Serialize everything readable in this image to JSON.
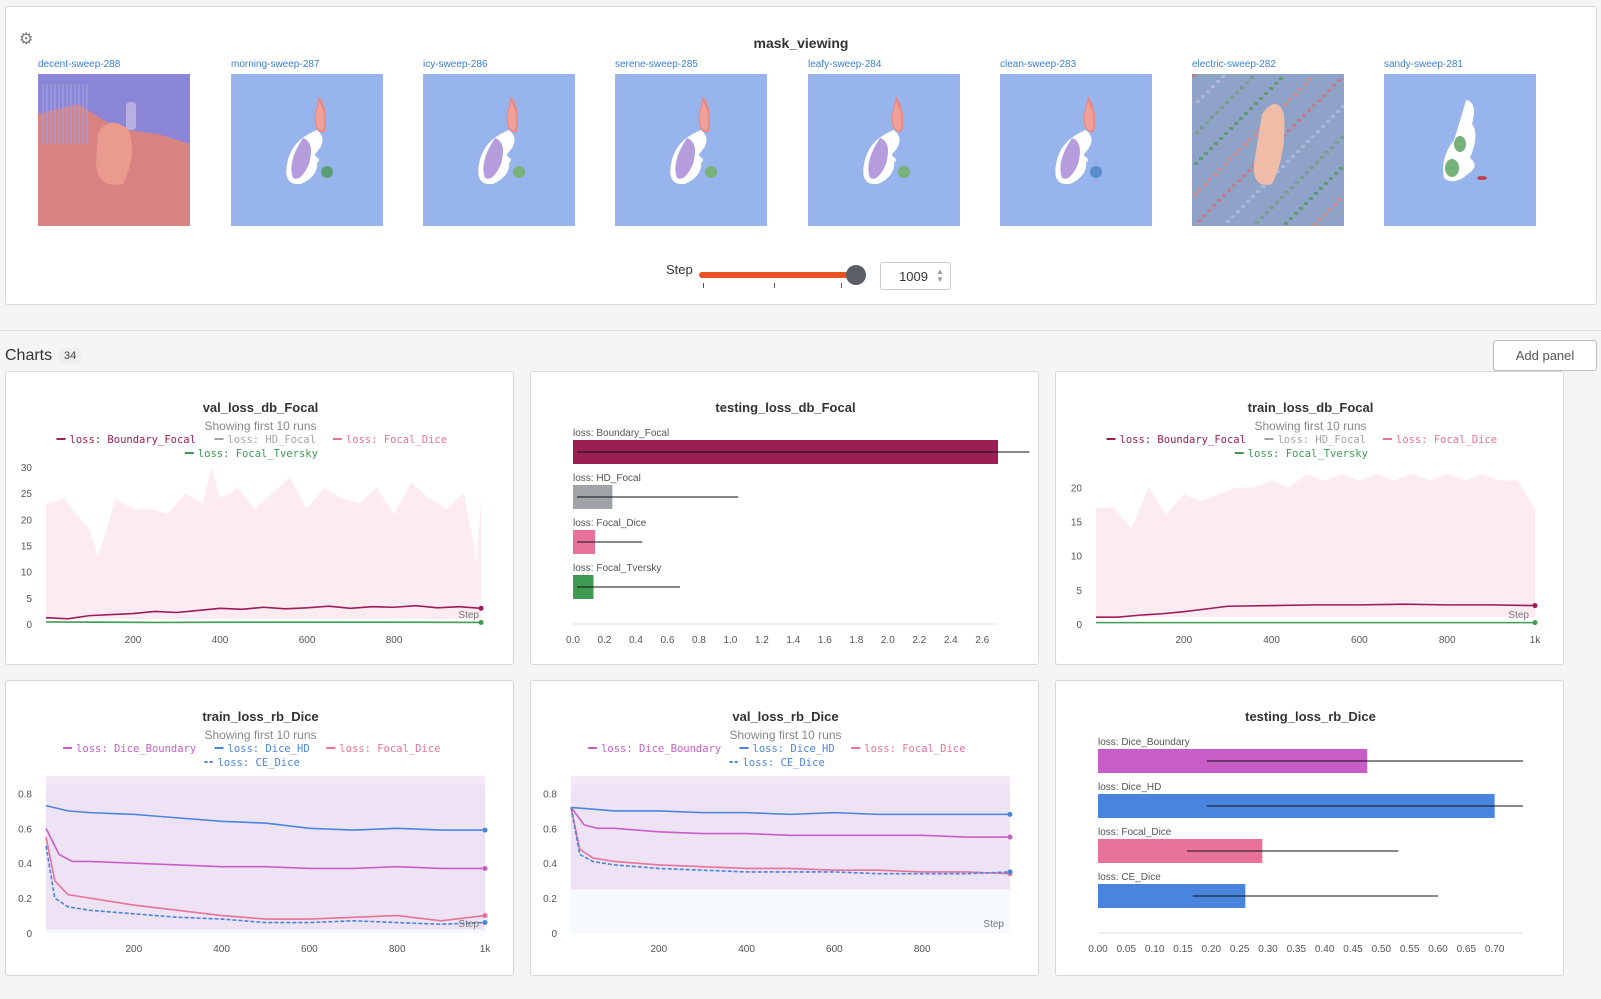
{
  "mask_panel": {
    "title": "mask_viewing",
    "runs": [
      "decent-sweep-288",
      "morning-sweep-287",
      "icy-sweep-286",
      "serene-sweep-285",
      "leafy-sweep-284",
      "clean-sweep-283",
      "electric-sweep-282",
      "sandy-sweep-281"
    ],
    "step_label": "Step",
    "step_value": "1009",
    "slider_fraction": 1.0,
    "settings_icon": "gear-icon"
  },
  "charts_section": {
    "label": "Charts",
    "count": "34",
    "add_panel": "Add panel"
  },
  "colors": {
    "Boundary_Focal": "#9b1e55",
    "HD_Focal": "#a0a4a8",
    "Focal_Dice": "#e8729a",
    "Focal_Tversky": "#3e9a52",
    "Dice_Boundary": "#c95dc8",
    "Dice_HD": "#4a85dd",
    "CE_Dice": "#4a85dd",
    "accent": "#e9541f"
  },
  "charts": [
    {
      "type": "line",
      "title": "val_loss_db_Focal",
      "subtitle": "Showing first 10 runs",
      "legend_rows": [
        [
          "Boundary_Focal",
          "HD_Focal",
          "Focal_Dice"
        ],
        [
          "Focal_Tversky"
        ]
      ],
      "ylim": [
        0,
        30
      ],
      "yticks": [
        "0",
        "5",
        "10",
        "15",
        "20",
        "25",
        "30"
      ],
      "xmin": 0,
      "xmax": 1009,
      "xticks": [
        {
          "v": 200,
          "l": "200"
        },
        {
          "v": 400,
          "l": "400"
        },
        {
          "v": 600,
          "l": "600"
        },
        {
          "v": 800,
          "l": "800"
        }
      ],
      "step_label": "Step",
      "band": {
        "color": "#e8729a",
        "lo": 1,
        "hi_x": [
          0,
          40,
          80,
          100,
          120,
          160,
          200,
          240,
          280,
          320,
          360,
          380,
          400,
          440,
          480,
          520,
          560,
          600,
          640,
          680,
          720,
          760,
          800,
          840,
          880,
          920,
          960,
          990,
          1000
        ],
        "hi_y": [
          23,
          24,
          20,
          18,
          13,
          24,
          22,
          22,
          21,
          25,
          23,
          31,
          24,
          26,
          22,
          25,
          28,
          22,
          26,
          24,
          23,
          26,
          21,
          27,
          24,
          22,
          25,
          12,
          24
        ]
      },
      "series": [
        {
          "name": "Boundary_Focal",
          "x": [
            0,
            50,
            100,
            150,
            200,
            250,
            300,
            350,
            400,
            450,
            500,
            550,
            600,
            650,
            700,
            750,
            800,
            850,
            900,
            950,
            1000
          ],
          "y": [
            1.2,
            1.0,
            1.6,
            1.8,
            2.0,
            2.4,
            2.2,
            2.6,
            3.0,
            2.8,
            3.2,
            2.9,
            3.1,
            3.4,
            3.0,
            3.3,
            3.2,
            3.5,
            3.1,
            3.3,
            3.0
          ]
        },
        {
          "name": "Focal_Tversky",
          "x": [
            0,
            250,
            500,
            750,
            1000
          ],
          "y": [
            0.4,
            0.3,
            0.35,
            0.35,
            0.3
          ]
        }
      ]
    },
    {
      "type": "hbar",
      "title": "testing_loss_db_Focal",
      "xlim": [
        0,
        2.7
      ],
      "xticks": [
        "0.0",
        "0.2",
        "0.4",
        "0.6",
        "0.8",
        "1.0",
        "1.2",
        "1.4",
        "1.6",
        "1.8",
        "2.0",
        "2.2",
        "2.4",
        "2.6"
      ],
      "bars": [
        {
          "label": "loss: Boundary_Focal",
          "key": "Boundary_Focal",
          "value": 2.7,
          "err_lo": 0.0,
          "err_hi": 2.9
        },
        {
          "label": "loss: HD_Focal",
          "key": "HD_Focal",
          "value": 0.25,
          "err_lo": 0.0,
          "err_hi": 1.05
        },
        {
          "label": "loss: Focal_Dice",
          "key": "Focal_Dice",
          "value": 0.14,
          "err_lo": 0.0,
          "err_hi": 0.44
        },
        {
          "label": "loss: Focal_Tversky",
          "key": "Focal_Tversky",
          "value": 0.13,
          "err_lo": 0.0,
          "err_hi": 0.68
        }
      ]
    },
    {
      "type": "line",
      "title": "train_loss_db_Focal",
      "subtitle": "Showing first 10 runs",
      "legend_rows": [
        [
          "Boundary_Focal",
          "HD_Focal",
          "Focal_Dice"
        ],
        [
          "Focal_Tversky"
        ]
      ],
      "ylim": [
        0,
        23
      ],
      "yticks": [
        "0",
        "5",
        "10",
        "15",
        "20"
      ],
      "xmin": 0,
      "xmax": 1000,
      "xticks": [
        {
          "v": 200,
          "l": "200"
        },
        {
          "v": 400,
          "l": "400"
        },
        {
          "v": 600,
          "l": "600"
        },
        {
          "v": 800,
          "l": "800"
        },
        {
          "v": 1000,
          "l": "1k"
        }
      ],
      "step_label": "Step",
      "band": {
        "color": "#e8729a",
        "lo": 1,
        "hi_x": [
          0,
          40,
          80,
          120,
          160,
          200,
          240,
          280,
          320,
          360,
          400,
          440,
          480,
          520,
          560,
          600,
          640,
          680,
          720,
          760,
          800,
          840,
          880,
          920,
          960,
          1000
        ],
        "hi_y": [
          17,
          17,
          14,
          20,
          16,
          19,
          18,
          19,
          20,
          20,
          21,
          20,
          22,
          21,
          22,
          21,
          22,
          21,
          22,
          21,
          22,
          21,
          22,
          21,
          21,
          17
        ]
      },
      "series": [
        {
          "name": "Boundary_Focal",
          "x": [
            0,
            50,
            100,
            150,
            200,
            250,
            300,
            400,
            500,
            600,
            700,
            800,
            900,
            1000
          ],
          "y": [
            1.0,
            1.0,
            1.3,
            1.5,
            1.8,
            2.2,
            2.6,
            2.7,
            2.8,
            2.8,
            2.9,
            2.8,
            2.8,
            2.7
          ]
        },
        {
          "name": "Focal_Tversky",
          "x": [
            0,
            500,
            1000
          ],
          "y": [
            0.2,
            0.2,
            0.2
          ]
        }
      ]
    },
    {
      "type": "line",
      "title": "train_loss_rb_Dice",
      "subtitle": "Showing first 10 runs",
      "legend_rows": [
        [
          "Dice_Boundary",
          "Dice_HD",
          "Focal_Dice"
        ],
        [
          "CE_Dice"
        ]
      ],
      "ylim": [
        0,
        0.9
      ],
      "yticks": [
        "0",
        "0.2",
        "0.4",
        "0.6",
        "0.8"
      ],
      "xmin": 0,
      "xmax": 1000,
      "xticks": [
        {
          "v": 200,
          "l": "200"
        },
        {
          "v": 400,
          "l": "400"
        },
        {
          "v": 600,
          "l": "600"
        },
        {
          "v": 800,
          "l": "800"
        },
        {
          "v": 1000,
          "l": "1k"
        }
      ],
      "step_label": "Step",
      "band": {
        "color": "#c95dc8",
        "lo": 0.02,
        "hi_x": [
          0,
          1000
        ],
        "hi_y": [
          0.9,
          0.9
        ]
      },
      "series": [
        {
          "name": "Dice_HD",
          "x": [
            0,
            50,
            100,
            200,
            300,
            400,
            500,
            600,
            700,
            800,
            900,
            1000
          ],
          "y": [
            0.73,
            0.7,
            0.69,
            0.68,
            0.66,
            0.64,
            0.63,
            0.6,
            0.59,
            0.6,
            0.59,
            0.59
          ]
        },
        {
          "name": "Dice_Boundary",
          "x": [
            0,
            30,
            60,
            100,
            200,
            300,
            400,
            500,
            600,
            700,
            800,
            900,
            1000
          ],
          "y": [
            0.6,
            0.45,
            0.41,
            0.41,
            0.4,
            0.39,
            0.38,
            0.38,
            0.37,
            0.37,
            0.38,
            0.37,
            0.37
          ]
        },
        {
          "name": "Focal_Dice",
          "x": [
            0,
            20,
            50,
            100,
            200,
            300,
            400,
            500,
            600,
            700,
            800,
            900,
            1000
          ],
          "y": [
            0.55,
            0.3,
            0.22,
            0.2,
            0.16,
            0.13,
            0.1,
            0.08,
            0.08,
            0.09,
            0.1,
            0.07,
            0.1
          ]
        },
        {
          "name": "CE_Dice",
          "x": [
            0,
            20,
            50,
            100,
            200,
            300,
            400,
            500,
            600,
            700,
            800,
            900,
            1000
          ],
          "y": [
            0.5,
            0.2,
            0.15,
            0.13,
            0.11,
            0.09,
            0.08,
            0.06,
            0.06,
            0.07,
            0.06,
            0.05,
            0.06
          ]
        }
      ]
    },
    {
      "type": "line",
      "title": "val_loss_rb_Dice",
      "subtitle": "Showing first 10 runs",
      "legend_rows": [
        [
          "Dice_Boundary",
          "Dice_HD",
          "Focal_Dice"
        ],
        [
          "CE_Dice"
        ]
      ],
      "ylim": [
        0,
        0.9
      ],
      "yticks": [
        "0",
        "0.2",
        "0.4",
        "0.6",
        "0.8"
      ],
      "xmin": 0,
      "xmax": 1000,
      "xticks": [
        {
          "v": 200,
          "l": "200"
        },
        {
          "v": 400,
          "l": "400"
        },
        {
          "v": 600,
          "l": "600"
        },
        {
          "v": 800,
          "l": "800"
        }
      ],
      "step_label": "Step",
      "band": {
        "color": "#c95dc8",
        "lo": 0.25,
        "hi_x": [
          0,
          1000
        ],
        "hi_y": [
          0.9,
          0.9
        ]
      },
      "series": [
        {
          "name": "Dice_HD",
          "x": [
            0,
            50,
            100,
            200,
            300,
            400,
            500,
            600,
            700,
            800,
            900,
            1000
          ],
          "y": [
            0.72,
            0.71,
            0.7,
            0.7,
            0.69,
            0.69,
            0.68,
            0.69,
            0.68,
            0.68,
            0.68,
            0.68
          ]
        },
        {
          "name": "Dice_Boundary",
          "x": [
            0,
            30,
            60,
            100,
            200,
            300,
            400,
            500,
            600,
            700,
            800,
            900,
            1000
          ],
          "y": [
            0.72,
            0.62,
            0.6,
            0.6,
            0.58,
            0.57,
            0.57,
            0.56,
            0.56,
            0.56,
            0.56,
            0.55,
            0.55
          ]
        },
        {
          "name": "Focal_Dice",
          "x": [
            0,
            20,
            50,
            100,
            200,
            300,
            400,
            500,
            600,
            700,
            800,
            900,
            1000
          ],
          "y": [
            0.72,
            0.48,
            0.43,
            0.41,
            0.39,
            0.38,
            0.37,
            0.37,
            0.36,
            0.36,
            0.35,
            0.35,
            0.34
          ]
        },
        {
          "name": "CE_Dice",
          "x": [
            0,
            20,
            50,
            100,
            200,
            300,
            400,
            500,
            600,
            700,
            800,
            900,
            1000
          ],
          "y": [
            0.72,
            0.45,
            0.41,
            0.39,
            0.37,
            0.36,
            0.35,
            0.35,
            0.35,
            0.34,
            0.34,
            0.34,
            0.35
          ]
        }
      ]
    },
    {
      "type": "hbar",
      "title": "testing_loss_rb_Dice",
      "xlim": [
        0,
        0.75
      ],
      "xticks": [
        "0.00",
        "0.05",
        "0.10",
        "0.15",
        "0.20",
        "0.25",
        "0.30",
        "0.35",
        "0.40",
        "0.45",
        "0.50",
        "0.55",
        "0.60",
        "0.65",
        "0.70"
      ],
      "bars": [
        {
          "label": "loss: Dice_Boundary",
          "key": "Dice_Boundary",
          "value": 0.475,
          "err_lo": 0.185,
          "err_hi": 0.75
        },
        {
          "label": "loss: Dice_HD",
          "key": "Dice_HD",
          "value": 0.7,
          "err_lo": 0.185,
          "err_hi": 0.75
        },
        {
          "label": "loss: Focal_Dice",
          "key": "Focal_Dice",
          "value": 0.29,
          "err_lo": 0.15,
          "err_hi": 0.53
        },
        {
          "label": "loss: CE_Dice",
          "key": "CE_Dice",
          "value": 0.26,
          "err_lo": 0.16,
          "err_hi": 0.6
        }
      ]
    }
  ]
}
